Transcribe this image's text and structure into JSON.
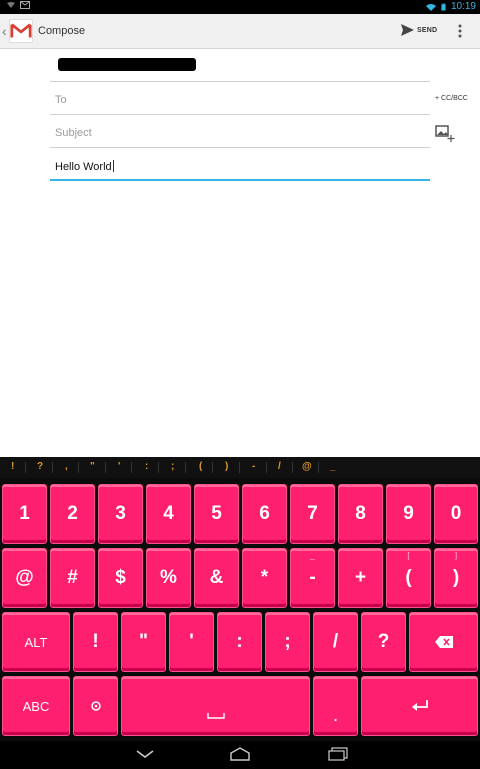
{
  "status": {
    "time": "10:19"
  },
  "action_bar": {
    "title": "Compose",
    "send_label": "SEND"
  },
  "compose": {
    "to_placeholder": "To",
    "subject_placeholder": "Subject",
    "body_text": "Hello World",
    "cc_bcc_label": "+ CC/BCC"
  },
  "suggestions": [
    "!",
    "?",
    ",",
    "\"",
    "'",
    ":",
    ";",
    "(",
    ")",
    "-",
    "/",
    "@",
    "_"
  ],
  "keyboard": {
    "row1": [
      "1",
      "2",
      "3",
      "4",
      "5",
      "6",
      "7",
      "8",
      "9",
      "0"
    ],
    "row2": [
      "@",
      "#",
      "$",
      "%",
      "&",
      "*",
      "-",
      "+",
      "(",
      ")"
    ],
    "row2_hints": {
      "-": "_",
      "(": "[",
      ")": "]"
    },
    "row3": [
      "ALT",
      "!",
      "\"",
      "'",
      ":",
      ";",
      "/",
      "?"
    ],
    "row4": [
      "ABC",
      "."
    ],
    "colors": {
      "key": "#ff1f6f",
      "key_shadow": "#c8004c",
      "accent": "#33b5e5",
      "suggestion": "#e19b26"
    }
  }
}
